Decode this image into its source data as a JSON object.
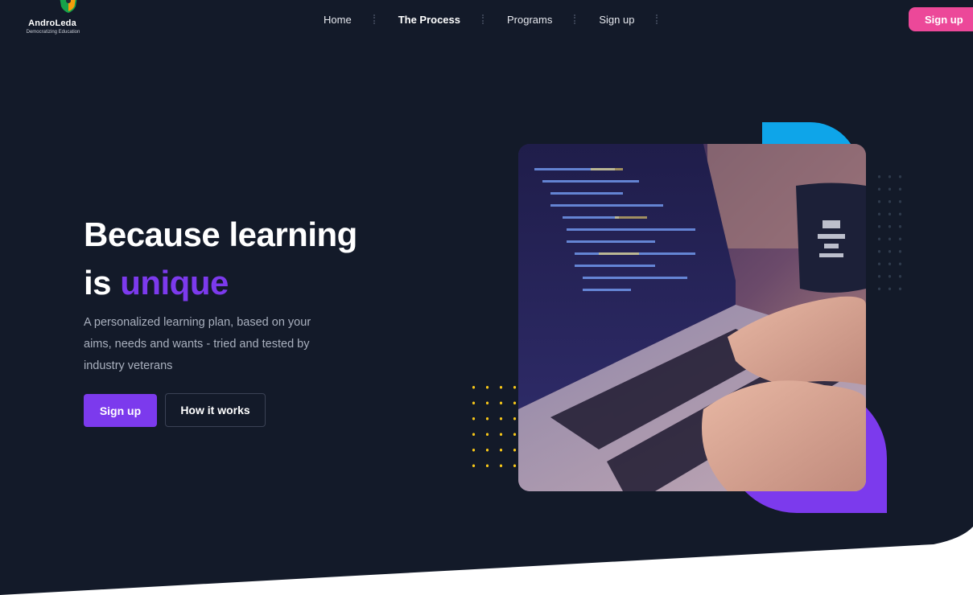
{
  "brand": {
    "name": "AndroLeda",
    "tagline": "Democratizing Education",
    "logo_icon": "shield-icon"
  },
  "nav": {
    "items": [
      {
        "label": "Home",
        "active": false
      },
      {
        "label": "The Process",
        "active": true
      },
      {
        "label": "Programs",
        "active": false
      },
      {
        "label": "Sign up",
        "active": false
      }
    ]
  },
  "header": {
    "signup_label": "Sign up"
  },
  "hero": {
    "title_line1": "Because learning",
    "title_line2_prefix": "is ",
    "title_accent": "unique",
    "description": "A personalized learning plan, based on your aims, needs and wants - tried and tested by industry veterans",
    "primary_button": "Sign up",
    "secondary_button": "How it works",
    "image_icon": "laptop-coding-image"
  },
  "colors": {
    "background": "#131a29",
    "accent_purple": "#7c3aed",
    "accent_pink": "#ec4899",
    "accent_blue": "#0ea5e9",
    "dots_yellow": "#f5c518"
  }
}
